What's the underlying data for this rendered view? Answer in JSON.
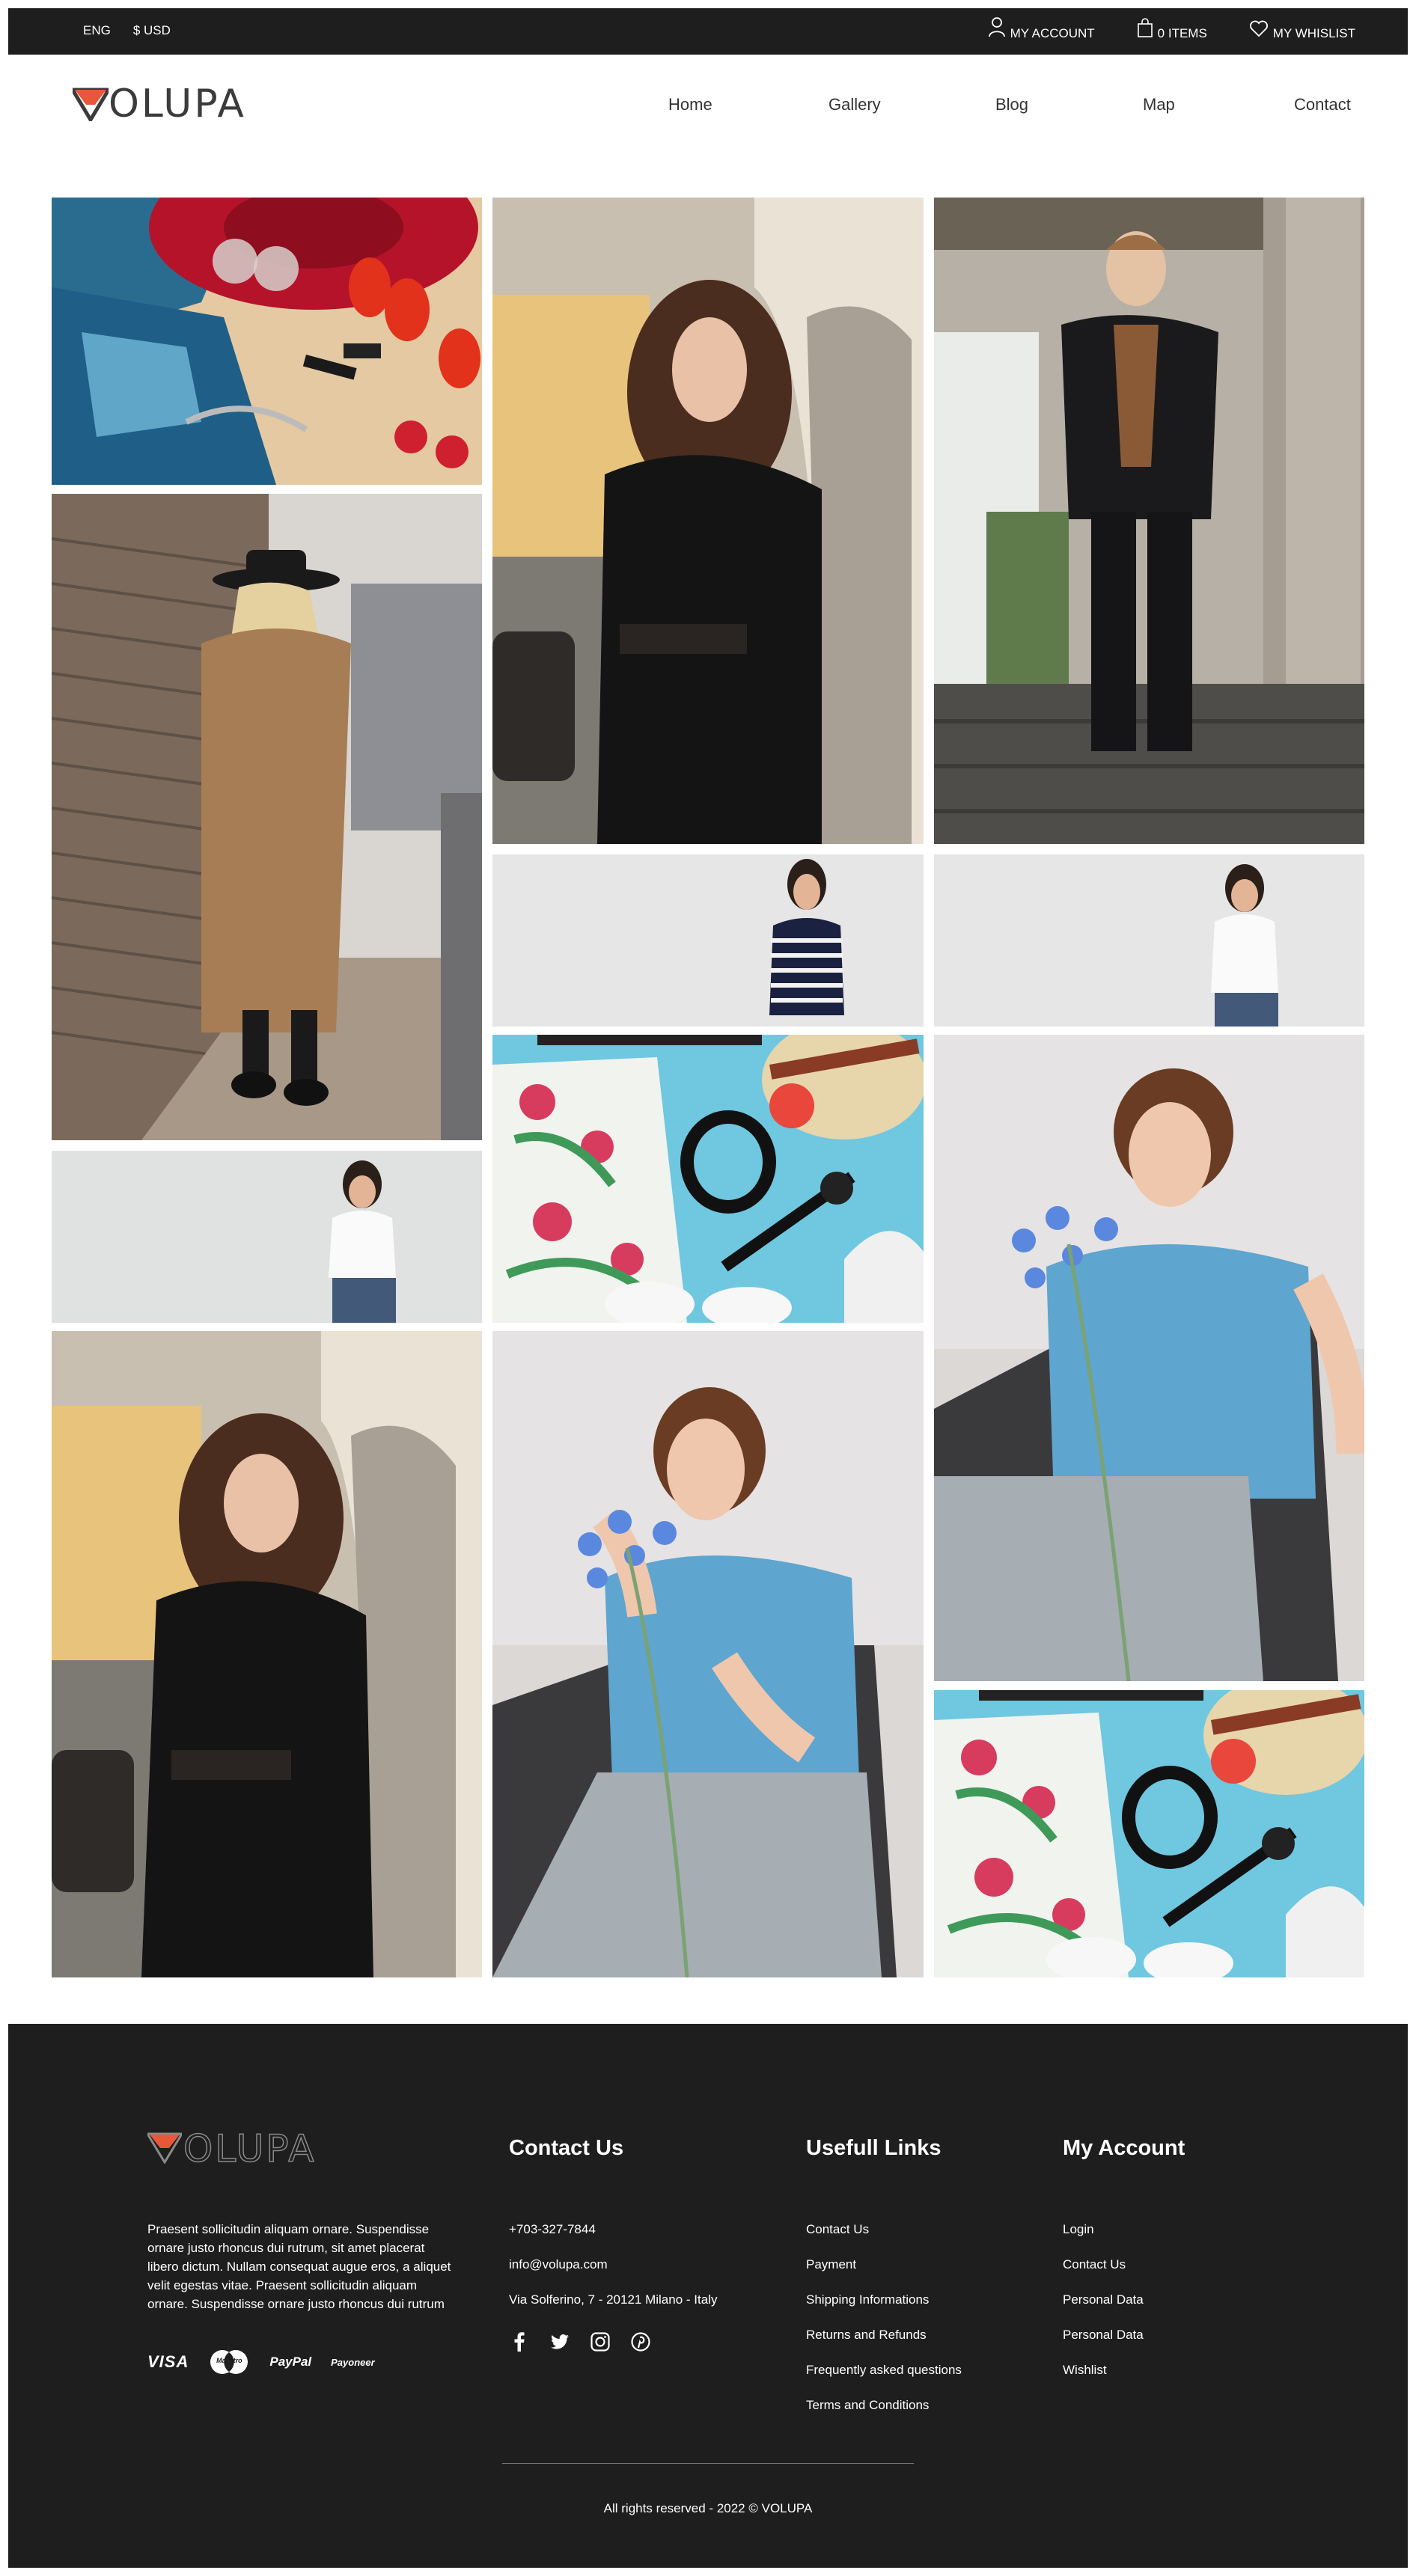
{
  "topbar": {
    "language": "ENG",
    "currency": "$ USD",
    "account_label": "MY ACCOUNT",
    "cart_label": "0 ITEMS",
    "wishlist_label": "MY WHISLIST"
  },
  "brand": {
    "name": "VOLUPA",
    "accent_color": "#e8573a"
  },
  "nav": {
    "items": [
      "Home",
      "Gallery",
      "Blog",
      "Map",
      "Contact"
    ]
  },
  "footer": {
    "about": "Praesent sollicitudin aliquam ornare. Suspendisse ornare justo rhoncus dui rutrum, sit amet placerat libero dictum. Nullam consequat augue eros, a aliquet velit egestas vitae. Praesent sollicitudin aliquam ornare. Suspendisse ornare justo rhoncus dui rutrum",
    "payments": [
      "VISA",
      "Maestro",
      "PayPal",
      "Payoneer"
    ],
    "contact": {
      "title": "Contact Us",
      "phone": "+703-327-7844",
      "email": "info@volupa.com",
      "address": "Via Solferino, 7 - 20121 Milano - Italy",
      "social": [
        "facebook-icon",
        "twitter-icon",
        "instagram-icon",
        "pinterest-icon"
      ]
    },
    "links": {
      "title": "Usefull Links",
      "items": [
        "Contact Us",
        "Payment",
        "Shipping Informations",
        "Returns and Refunds",
        "Frequently asked questions",
        "Terms and Conditions"
      ]
    },
    "account": {
      "title": "My Account",
      "items": [
        "Login",
        "Contact Us",
        "Personal Data",
        "Personal Data",
        "Wishlist"
      ]
    },
    "copyright": "All rights reserved - 2022 © VOLUPA"
  }
}
